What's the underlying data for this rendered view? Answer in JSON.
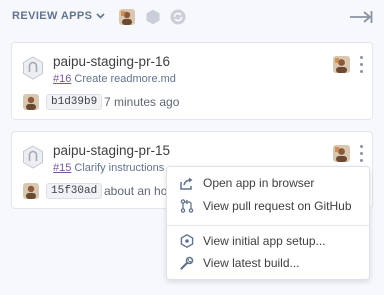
{
  "header": {
    "title": "REVIEW APPS",
    "icons": [
      "chevron-down-icon",
      "avatar",
      "hexagon-icon",
      "sync-icon",
      "arrow-right-icon"
    ]
  },
  "apps": [
    {
      "name": "paipu-staging-pr-16",
      "pr_number": "#16",
      "pr_title": "Create readmore.md",
      "sha": "b1d39b9",
      "time": "7 minutes ago"
    },
    {
      "name": "paipu-staging-pr-15",
      "pr_number": "#15",
      "pr_title": "Clarify instructions",
      "sha": "15f30ad",
      "time": "about an ho"
    }
  ],
  "menu": {
    "items": [
      {
        "label": "Open app in browser",
        "icon": "external-link-icon"
      },
      {
        "label": "View pull request on GitHub",
        "icon": "pull-request-icon"
      },
      {
        "label": "View initial app setup...",
        "icon": "hexagon-setup-icon"
      },
      {
        "label": "View latest build...",
        "icon": "wrench-icon"
      }
    ]
  },
  "colors": {
    "accent": "#79589f",
    "muted": "#62738d",
    "background": "#f7f8fb"
  }
}
